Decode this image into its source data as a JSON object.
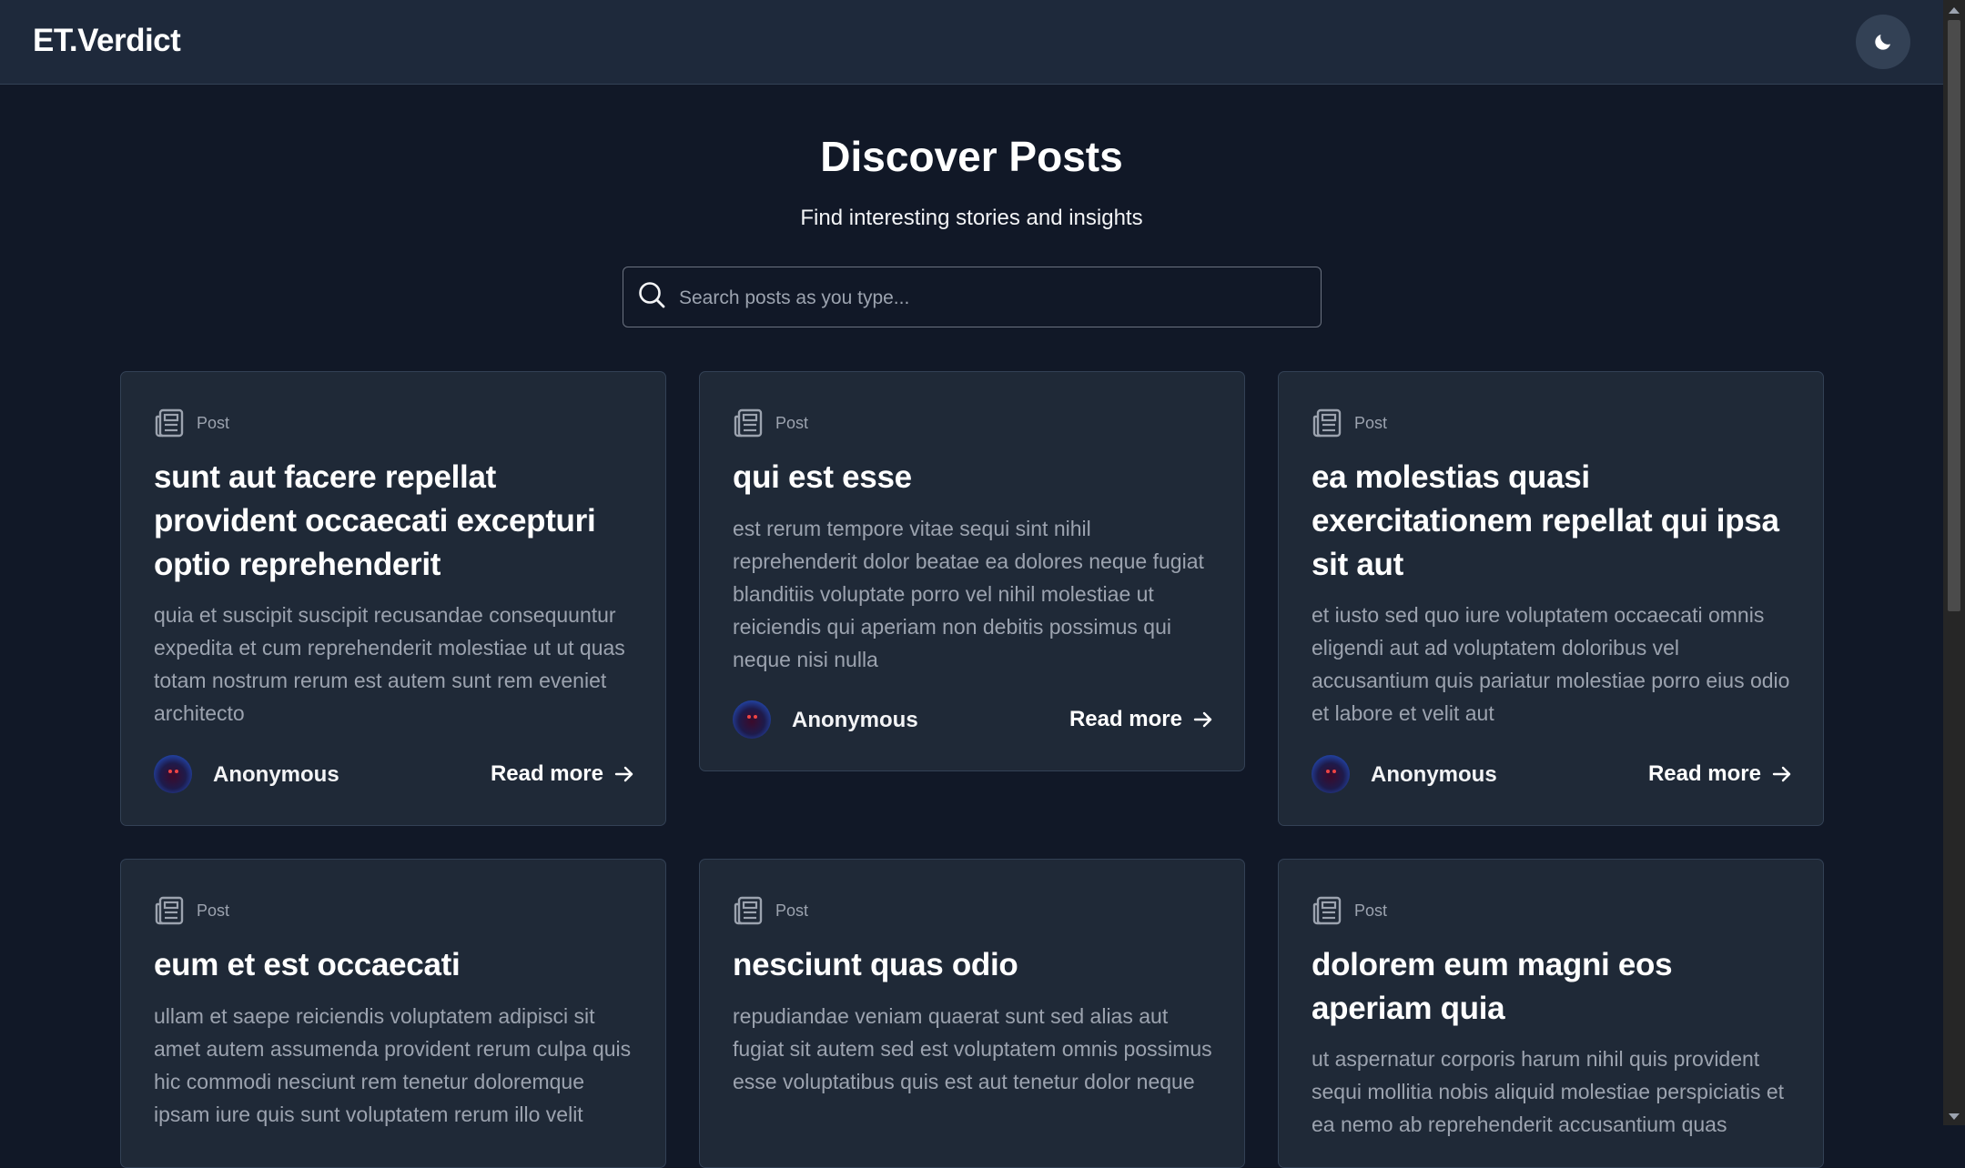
{
  "app": {
    "brand": "ET.Verdict",
    "theme_icon": "moon-icon"
  },
  "hero": {
    "title": "Discover Posts",
    "subtitle": "Find interesting stories and insights"
  },
  "search": {
    "placeholder": "Search posts as you type...",
    "value": ""
  },
  "colors": {
    "background": "#111827",
    "navbar": "#1e293b",
    "card": "#1f2937",
    "muted_text": "#9ca3af"
  },
  "posts": [
    {
      "type_label": "Post",
      "title": "sunt aut facere repellat provident occaecati excepturi optio reprehenderit",
      "body": "quia et suscipit suscipit recusandae consequuntur expedita et cum reprehenderit molestiae ut ut quas totam nostrum rerum est autem sunt rem eveniet architecto",
      "author": "Anonymous",
      "cta": "Read more"
    },
    {
      "type_label": "Post",
      "title": "qui est esse",
      "body": "est rerum tempore vitae sequi sint nihil reprehenderit dolor beatae ea dolores neque fugiat blanditiis voluptate porro vel nihil molestiae ut reiciendis qui aperiam non debitis possimus qui neque nisi nulla",
      "author": "Anonymous",
      "cta": "Read more"
    },
    {
      "type_label": "Post",
      "title": "ea molestias quasi exercitationem repellat qui ipsa sit aut",
      "body": "et iusto sed quo iure voluptatem occaecati omnis eligendi aut ad voluptatem doloribus vel accusantium quis pariatur molestiae porro eius odio et labore et velit aut",
      "author": "Anonymous",
      "cta": "Read more"
    },
    {
      "type_label": "Post",
      "title": "eum et est occaecati",
      "body": "ullam et saepe reiciendis voluptatem adipisci sit amet autem assumenda provident rerum culpa quis hic commodi nesciunt rem tenetur doloremque ipsam iure quis sunt voluptatem rerum illo velit"
    },
    {
      "type_label": "Post",
      "title": "nesciunt quas odio",
      "body": "repudiandae veniam quaerat sunt sed alias aut fugiat sit autem sed est voluptatem omnis possimus esse voluptatibus quis est aut tenetur dolor neque"
    },
    {
      "type_label": "Post",
      "title": "dolorem eum magni eos aperiam quia",
      "body": "ut aspernatur corporis harum nihil quis provident sequi mollitia nobis aliquid molestiae perspiciatis et ea nemo ab reprehenderit accusantium quas"
    }
  ]
}
